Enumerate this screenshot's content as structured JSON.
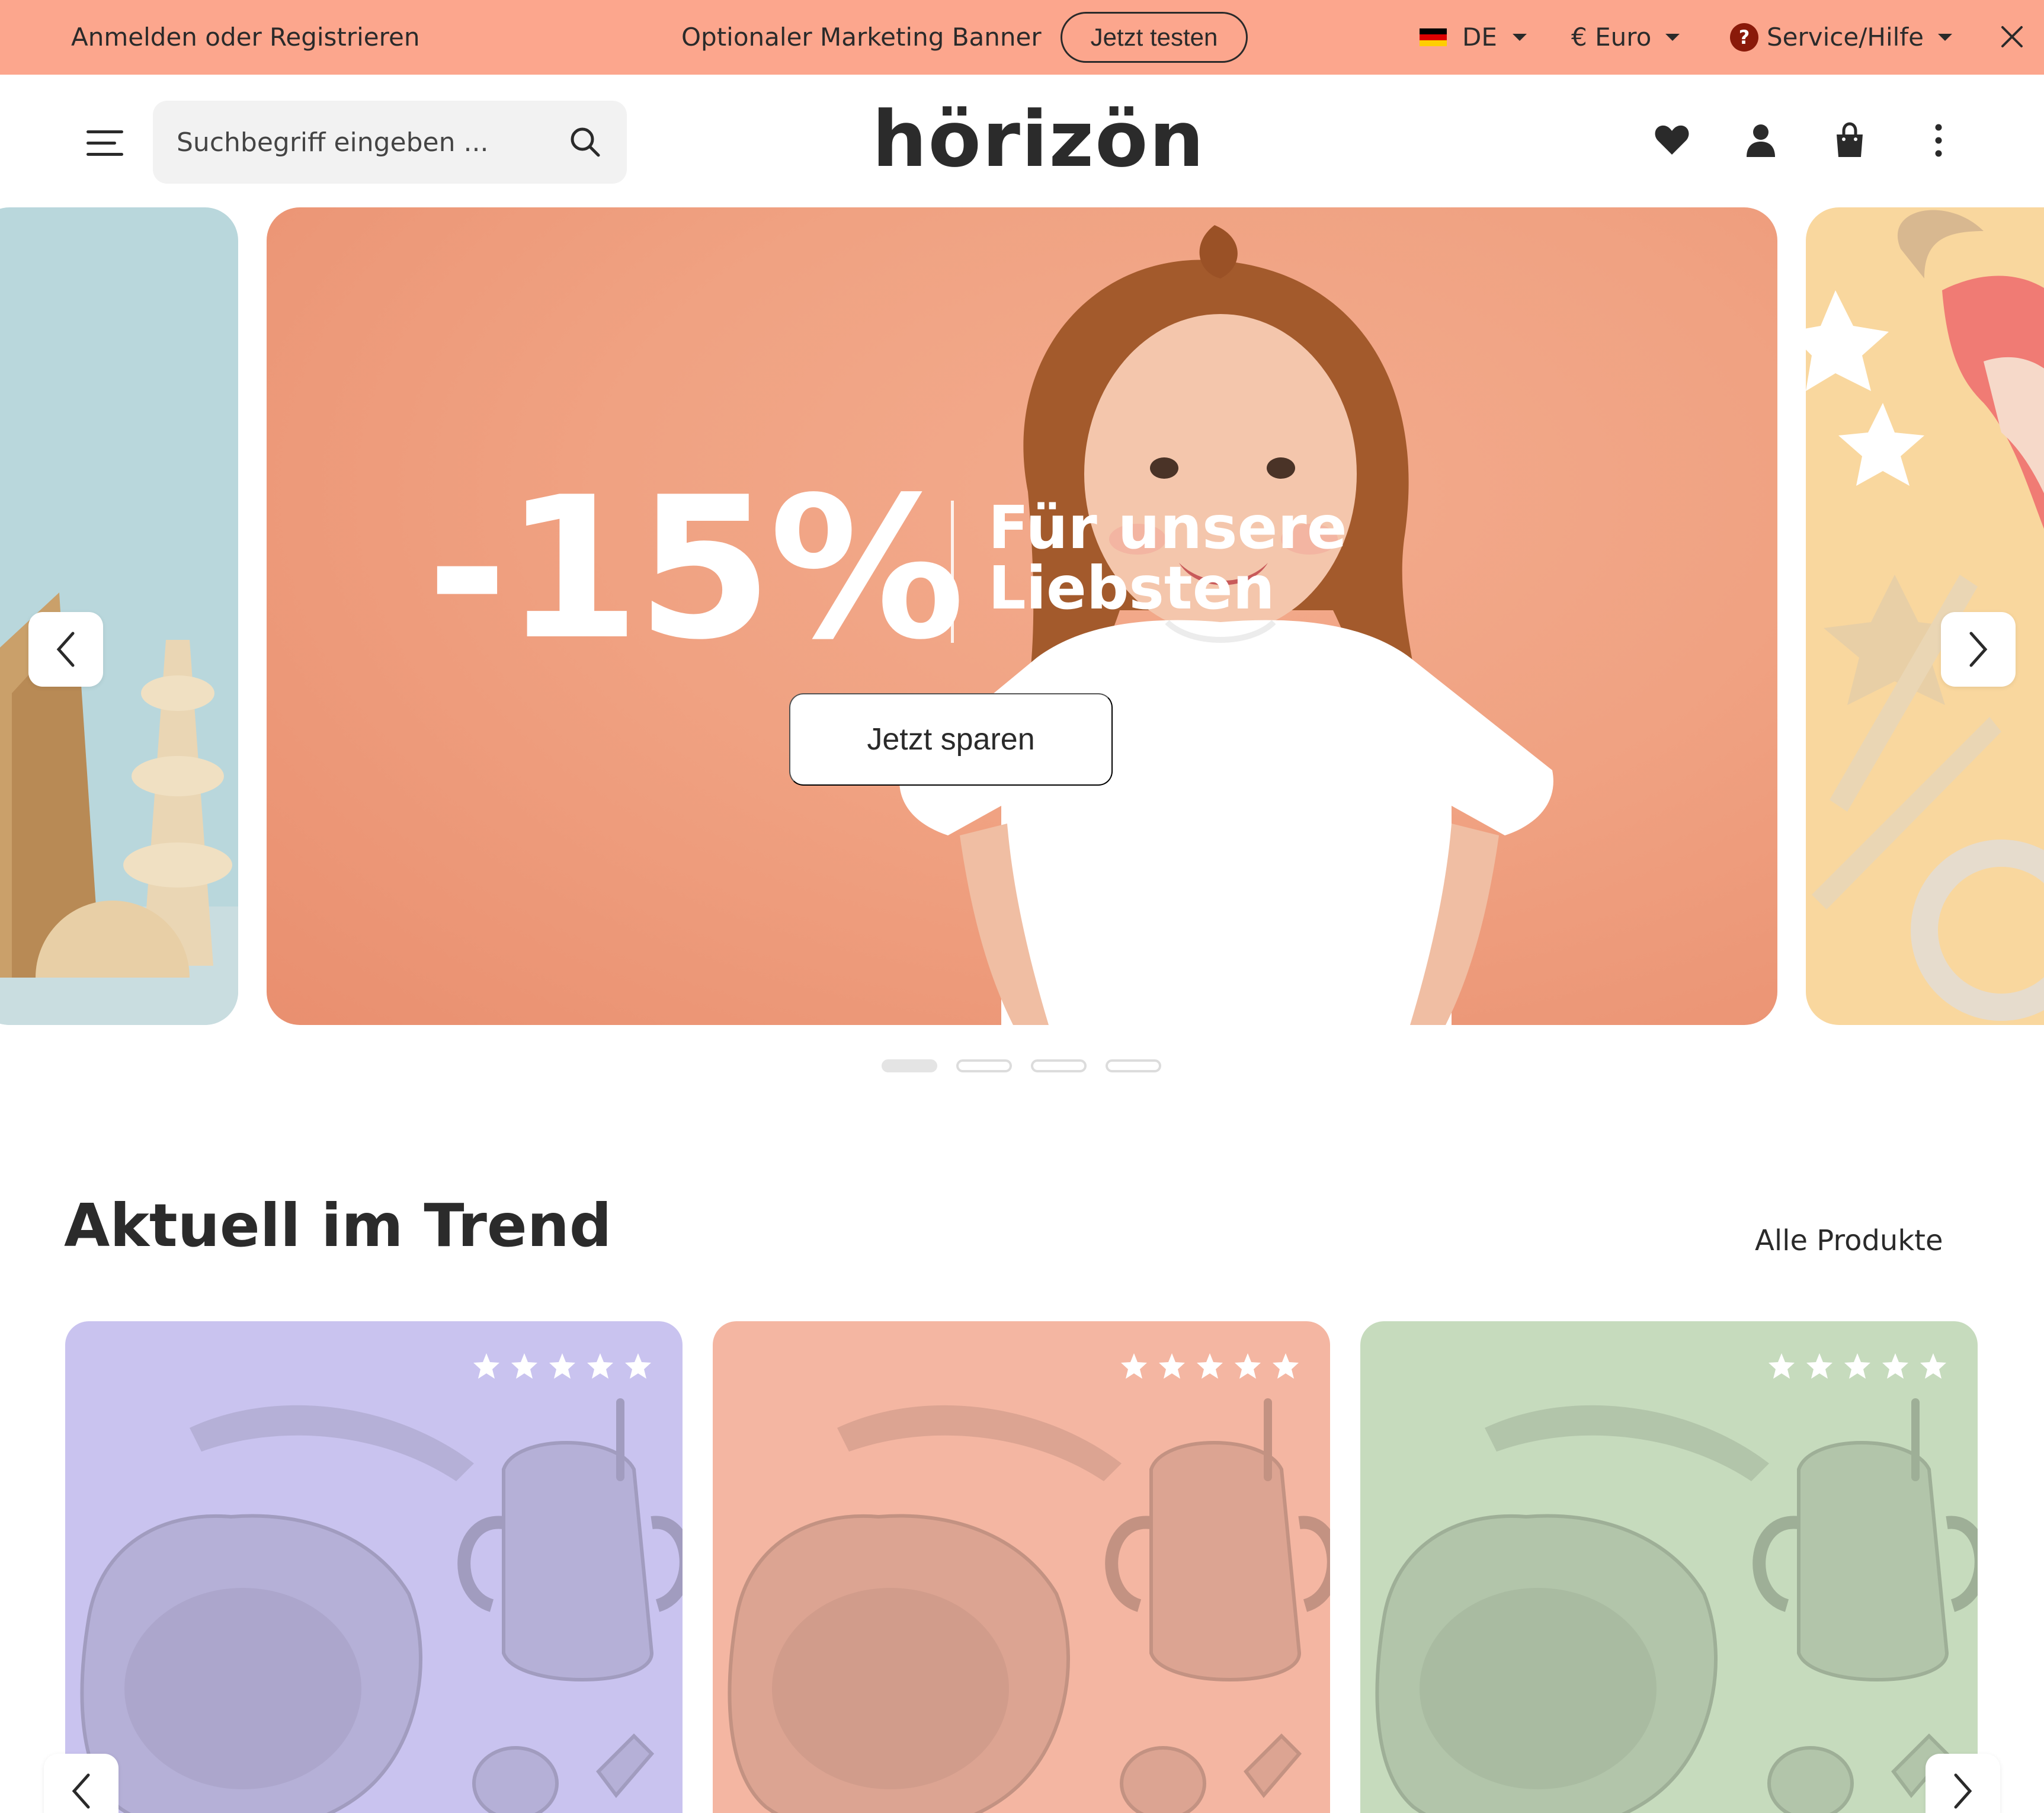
{
  "topbar": {
    "login_label": "Anmelden oder Registrieren",
    "banner_text": "Optionaler Marketing Banner",
    "try_button": "Jetzt testen",
    "language": "DE",
    "currency": "€ Euro",
    "service": "Service/Hilfe",
    "background": "#fca68d"
  },
  "header": {
    "search_placeholder": "Suchbegriff eingeben ...",
    "logo": "hörizön",
    "icons": [
      "menu-icon",
      "search-icon",
      "heart-icon",
      "user-icon",
      "cart-icon",
      "more-vertical-icon"
    ]
  },
  "hero": {
    "discount": "-15%",
    "subline": "Für unsere Liebsten",
    "button": "Jetzt sparen",
    "slides_count": 4,
    "active_slide": 1,
    "colors": {
      "main": "#f0a282",
      "left": "#b9d7dc",
      "right": "#f9d79e"
    }
  },
  "trend": {
    "title": "Aktuell im Trend",
    "all_products": "Alle Produkte",
    "products": [
      {
        "color": "#c9c3ef",
        "rating": 5
      },
      {
        "color": "#f4b6a2",
        "rating": 5
      },
      {
        "color": "#c6dbbd",
        "rating": 5
      }
    ]
  }
}
